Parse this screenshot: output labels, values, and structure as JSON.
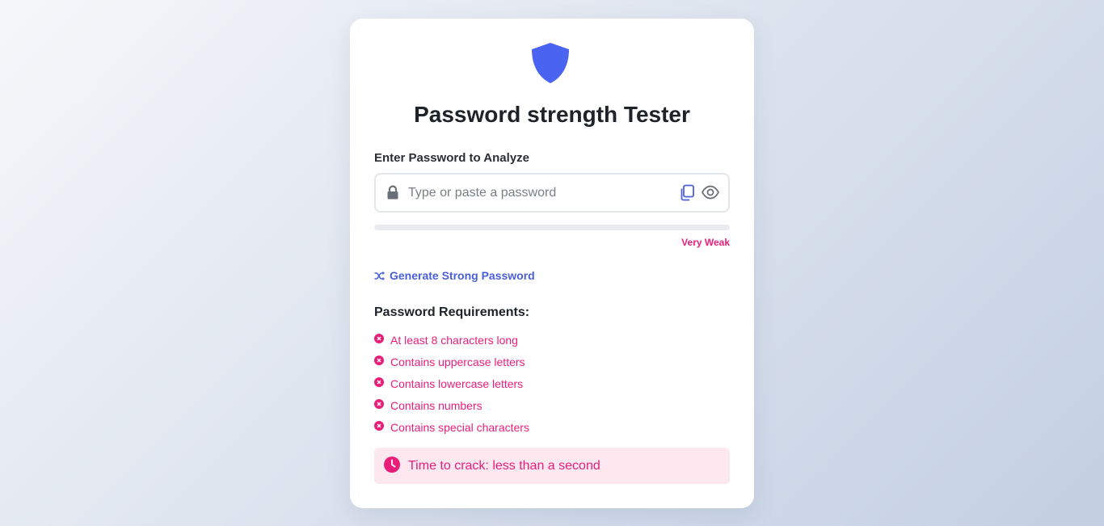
{
  "app": {
    "title": "Password strength Tester"
  },
  "colors": {
    "accent": "#4a5fd8",
    "shield": "#4a63f0",
    "danger": "#e91e7a",
    "danger_bg": "#fde8f0"
  },
  "input": {
    "label": "Enter Password to Analyze",
    "placeholder": "Type or paste a password",
    "value": "",
    "icons": [
      "lock-icon",
      "copy-icon",
      "eye-icon"
    ]
  },
  "strength": {
    "label": "Very Weak",
    "level": 0
  },
  "generate": {
    "label": "Generate Strong Password",
    "icon": "shuffle-icon"
  },
  "requirements": {
    "title": "Password Requirements:",
    "items": [
      {
        "label": "At least 8 characters long",
        "met": false
      },
      {
        "label": "Contains uppercase letters",
        "met": false
      },
      {
        "label": "Contains lowercase letters",
        "met": false
      },
      {
        "label": "Contains numbers",
        "met": false
      },
      {
        "label": "Contains special characters",
        "met": false
      }
    ]
  },
  "crack_time": {
    "text": "Time to crack: less than a second",
    "icon": "clock-icon"
  }
}
